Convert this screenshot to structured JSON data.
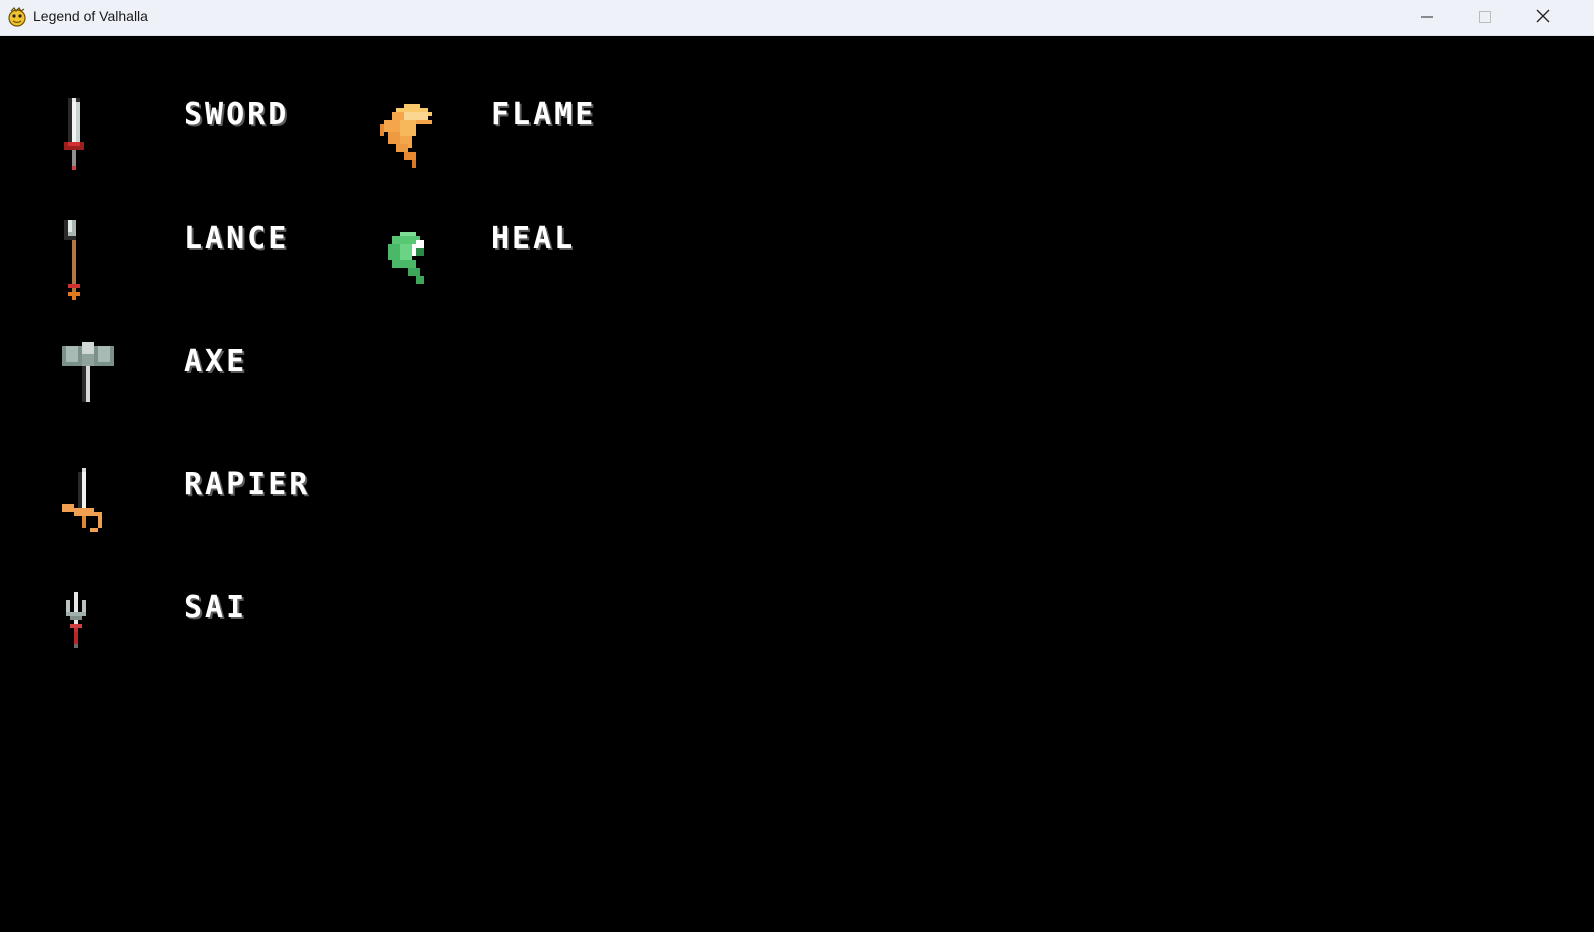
{
  "window": {
    "title": "Legend of Valhalla",
    "app_icon": "pygame-snake-icon",
    "controls": [
      "minimize-icon",
      "maximize-icon",
      "close-icon"
    ]
  },
  "weapons": [
    {
      "label": "SWORD",
      "icon": "sword-icon"
    },
    {
      "label": "LANCE",
      "icon": "lance-icon"
    },
    {
      "label": "AXE",
      "icon": "axe-icon"
    },
    {
      "label": "RAPIER",
      "icon": "rapier-icon"
    },
    {
      "label": "SAI",
      "icon": "sai-icon"
    }
  ],
  "magic": [
    {
      "label": "FLAME",
      "icon": "flame-icon"
    },
    {
      "label": "HEAL",
      "icon": "heal-icon"
    }
  ],
  "colors": {
    "background": "#000000",
    "label_text": "#ffffff",
    "flame": "#f6a64a",
    "heal": "#58c774"
  }
}
